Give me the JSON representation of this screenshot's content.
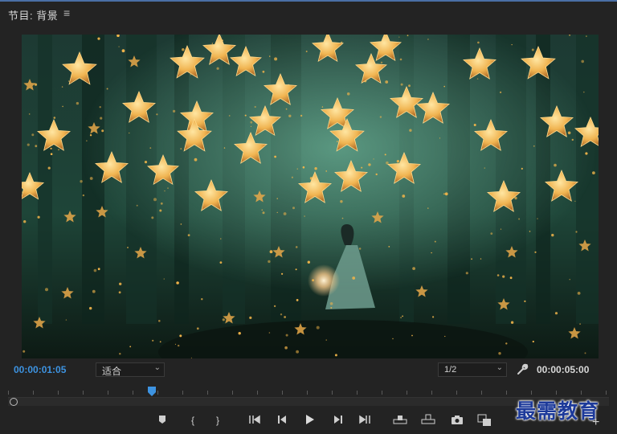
{
  "panel": {
    "title": "节目: 背景",
    "menu_icon": "hamburger-icon"
  },
  "viewer": {
    "content": "program-monitor-frame",
    "colors": {
      "forest": "#1f4a3c",
      "glow": "#f2b54a",
      "dark": "#0c1a16"
    }
  },
  "controls": {
    "current_timecode": "00:00:01:05",
    "fit_label": "适合",
    "resolution_label": "1/2",
    "duration_timecode": "00:00:05:00",
    "settings_icon": "wrench-icon",
    "accent": "#3d93e1"
  },
  "transport": {
    "buttons": [
      {
        "name": "add-marker",
        "icon": "marker-icon"
      },
      {
        "name": "mark-in",
        "icon": "mark-in-icon",
        "label": "{"
      },
      {
        "name": "mark-out",
        "icon": "mark-out-icon",
        "label": "}"
      },
      {
        "name": "go-to-in",
        "icon": "go-to-in-icon"
      },
      {
        "name": "step-back",
        "icon": "step-back-icon"
      },
      {
        "name": "play",
        "icon": "play-icon"
      },
      {
        "name": "step-forward",
        "icon": "step-forward-icon"
      },
      {
        "name": "go-to-out",
        "icon": "go-to-out-icon"
      },
      {
        "name": "lift",
        "icon": "lift-icon"
      },
      {
        "name": "extract",
        "icon": "extract-icon"
      },
      {
        "name": "export-frame",
        "icon": "camera-icon"
      },
      {
        "name": "compare-view",
        "icon": "compare-icon"
      }
    ],
    "add_label": "+"
  },
  "watermark": {
    "text": "最需教育"
  }
}
